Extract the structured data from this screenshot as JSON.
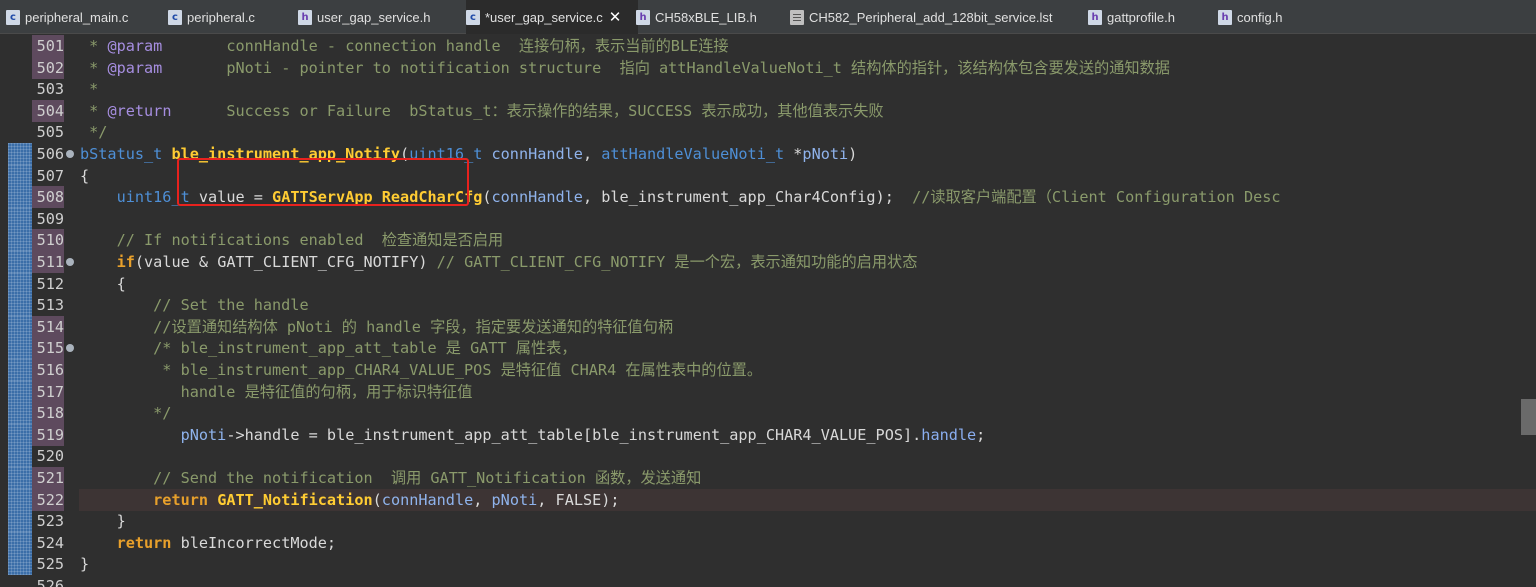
{
  "tabs": [
    {
      "label": "peripheral_main.c",
      "icon": "c"
    },
    {
      "label": "peripheral.c",
      "icon": "c"
    },
    {
      "label": "user_gap_service.h",
      "icon": "h"
    },
    {
      "label": "*user_gap_service.c",
      "icon": "c"
    },
    {
      "label": "CH58xBLE_LIB.h",
      "icon": "h"
    },
    {
      "label": "CH582_Peripheral_add_128bit_service.lst",
      "icon": "file"
    },
    {
      "label": "gattprofile.h",
      "icon": "h"
    },
    {
      "label": "config.h",
      "icon": "h"
    }
  ],
  "close_icon": "✕",
  "lines": [
    {
      "num": "501",
      "text": " * @param       connHandle - connection handle  连接句柄，表示当前的BLE连接"
    },
    {
      "num": "502",
      "text": " * @param       pNoti - pointer to notification structure  指向 attHandleValueNoti_t 结构体的指针，该结构体包含要发送的通知数据"
    },
    {
      "num": "503",
      "text": " *"
    },
    {
      "num": "504",
      "text": " * @return      Success or Failure  bStatus_t：表示操作的结果，SUCCESS 表示成功，其他值表示失败"
    },
    {
      "num": "505",
      "text": " */"
    },
    {
      "num": "506",
      "text": "bStatus_t ble_instrument_app_Notify(uint16_t connHandle, attHandleValueNoti_t *pNoti)"
    },
    {
      "num": "507",
      "text": "{"
    },
    {
      "num": "508",
      "text": "    uint16_t value = GATTServApp_ReadCharCfg(connHandle, ble_instrument_app_Char4Config);  //读取客户端配置（Client Configuration Desc"
    },
    {
      "num": "509",
      "text": ""
    },
    {
      "num": "510",
      "text": "    // If notifications enabled  检查通知是否启用"
    },
    {
      "num": "511",
      "text": "    if(value & GATT_CLIENT_CFG_NOTIFY) // GATT_CLIENT_CFG_NOTIFY 是一个宏，表示通知功能的启用状态"
    },
    {
      "num": "512",
      "text": "    {"
    },
    {
      "num": "513",
      "text": "        // Set the handle"
    },
    {
      "num": "514",
      "text": "        //设置通知结构体 pNoti 的 handle 字段，指定要发送通知的特征值句柄"
    },
    {
      "num": "515",
      "text": "        /* ble_instrument_app_att_table 是 GATT 属性表，"
    },
    {
      "num": "516",
      "text": "         * ble_instrument_app_CHAR4_VALUE_POS 是特征值 CHAR4 在属性表中的位置。"
    },
    {
      "num": "517",
      "text": "           handle 是特征值的句柄，用于标识特征值"
    },
    {
      "num": "518",
      "text": "        */"
    },
    {
      "num": "519",
      "text": "           pNoti->handle = ble_instrument_app_att_table[ble_instrument_app_CHAR4_VALUE_POS].handle;"
    },
    {
      "num": "520",
      "text": ""
    },
    {
      "num": "521",
      "text": "        // Send the notification  调用 GATT_Notification 函数，发送通知"
    },
    {
      "num": "522",
      "text": "        return GATT_Notification(connHandle, pNoti, FALSE);"
    },
    {
      "num": "523",
      "text": "    }"
    },
    {
      "num": "524",
      "text": "    return bleIncorrectMode;"
    },
    {
      "num": "525",
      "text": "}"
    },
    {
      "num": "526",
      "text": ""
    }
  ],
  "colors": {
    "editor_bg": "#2f2f2f",
    "comment": "#8a9a6b",
    "keyword": "#e8a02b",
    "type": "#4e8fd6",
    "function": "#ffcc33",
    "annotation_box": "#e8221e"
  }
}
